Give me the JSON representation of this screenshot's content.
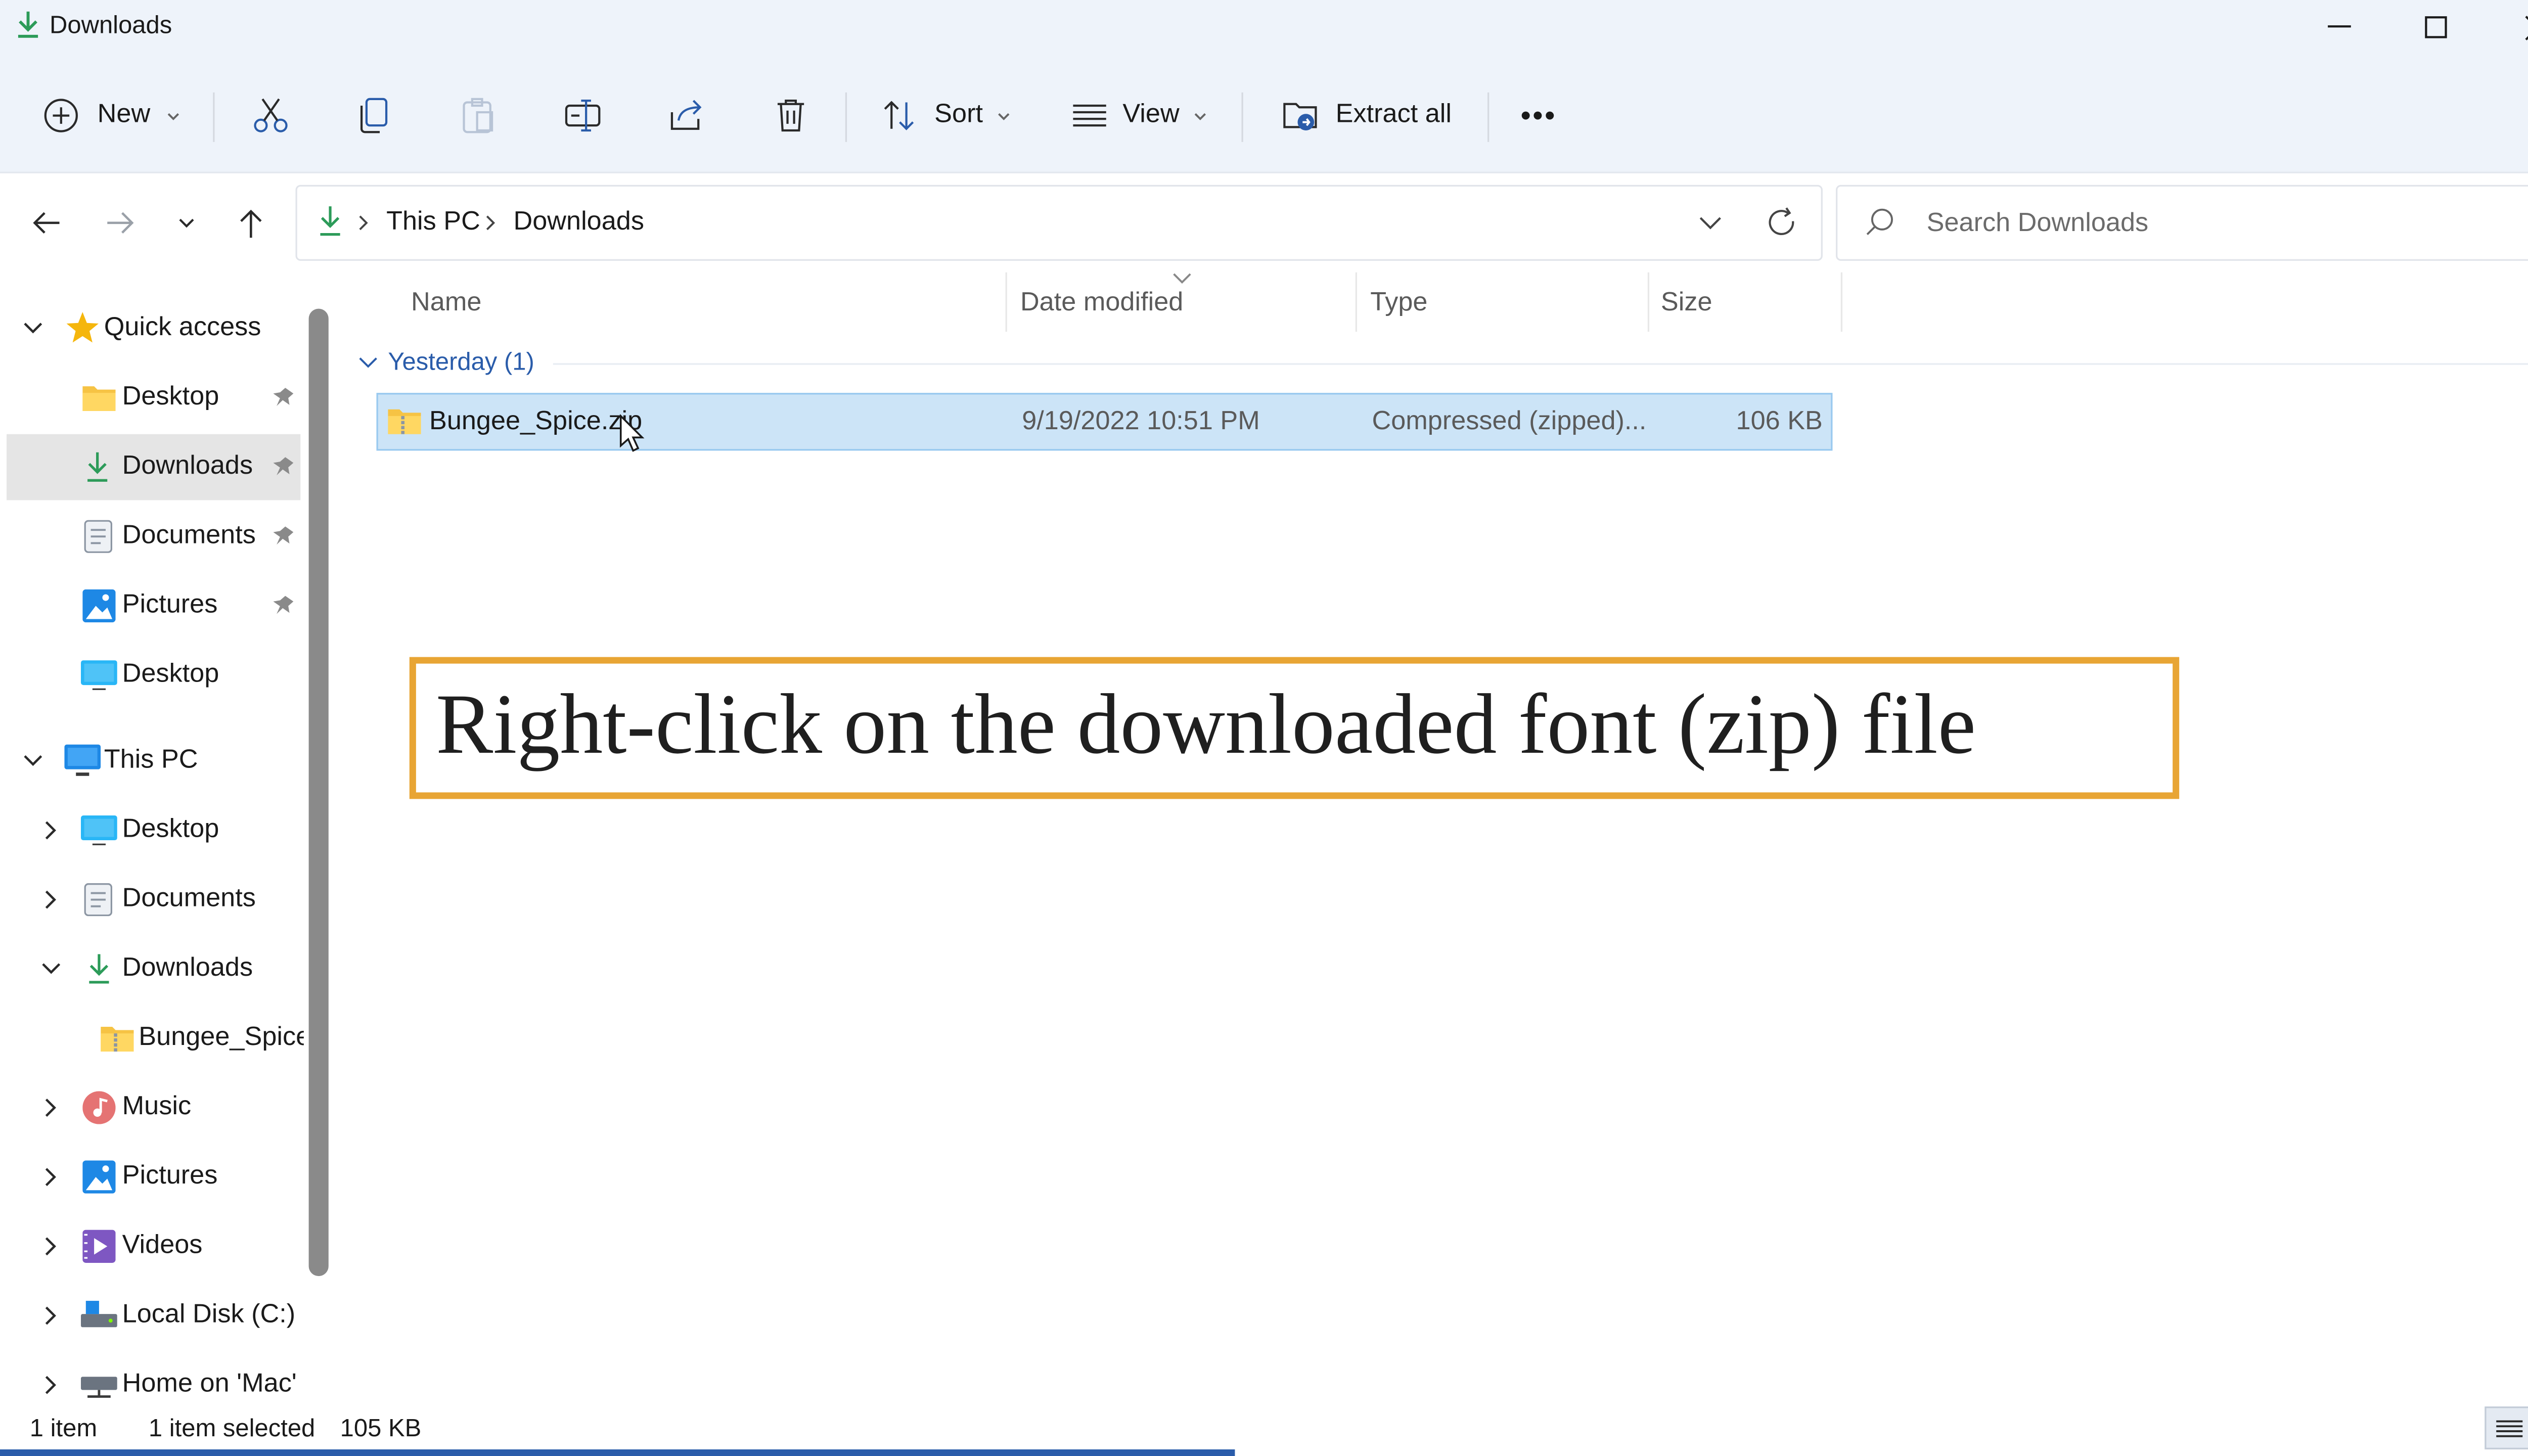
{
  "window": {
    "title": "Downloads"
  },
  "toolbar": {
    "new_label": "New",
    "sort_label": "Sort",
    "view_label": "View",
    "extract_label": "Extract all",
    "more_label": "•••"
  },
  "address": {
    "crumbs": [
      "This PC",
      "Downloads"
    ],
    "search_placeholder": "Search Downloads"
  },
  "sidebar": {
    "quick_access": {
      "label": "Quick access",
      "items": [
        {
          "label": "Desktop",
          "icon": "folder-yellow-icon",
          "pinned": true
        },
        {
          "label": "Downloads",
          "icon": "download-arrow-icon",
          "pinned": true,
          "selected": true
        },
        {
          "label": "Documents",
          "icon": "documents-icon",
          "pinned": true
        },
        {
          "label": "Pictures",
          "icon": "pictures-icon",
          "pinned": true
        },
        {
          "label": "Desktop",
          "icon": "desktop-icon",
          "pinned": false
        }
      ]
    },
    "this_pc": {
      "label": "This PC",
      "items": [
        {
          "label": "Desktop",
          "icon": "desktop-icon",
          "expanded": false
        },
        {
          "label": "Documents",
          "icon": "documents-icon",
          "expanded": false
        },
        {
          "label": "Downloads",
          "icon": "download-arrow-icon",
          "expanded": true
        },
        {
          "label": "Bungee_Spice",
          "icon": "zip-folder-icon",
          "child": true
        },
        {
          "label": "Music",
          "icon": "music-icon",
          "expanded": false
        },
        {
          "label": "Pictures",
          "icon": "pictures-icon",
          "expanded": false
        },
        {
          "label": "Videos",
          "icon": "videos-icon",
          "expanded": false
        },
        {
          "label": "Local Disk (C:)",
          "icon": "drive-icon",
          "expanded": false
        },
        {
          "label": "Home on 'Mac'",
          "icon": "network-drive-icon",
          "expanded": false
        }
      ]
    }
  },
  "filelist": {
    "columns": [
      "Name",
      "Date modified",
      "Type",
      "Size"
    ],
    "group_label": "Yesterday (1)",
    "rows": [
      {
        "name": "Bungee_Spice.zip",
        "date": "9/19/2022 10:51 PM",
        "type": "Compressed (zipped)...",
        "size": "106 KB",
        "selected": true
      }
    ]
  },
  "annotation": {
    "text": "Right-click on the downloaded font (zip) file",
    "border_color": "#e8a534"
  },
  "status": {
    "count": "1 item",
    "selected": "1 item selected",
    "size": "105 KB"
  },
  "colors": {
    "accent": "#2a5caa",
    "selection": "#cce4f7",
    "chrome": "#eef3fa"
  }
}
